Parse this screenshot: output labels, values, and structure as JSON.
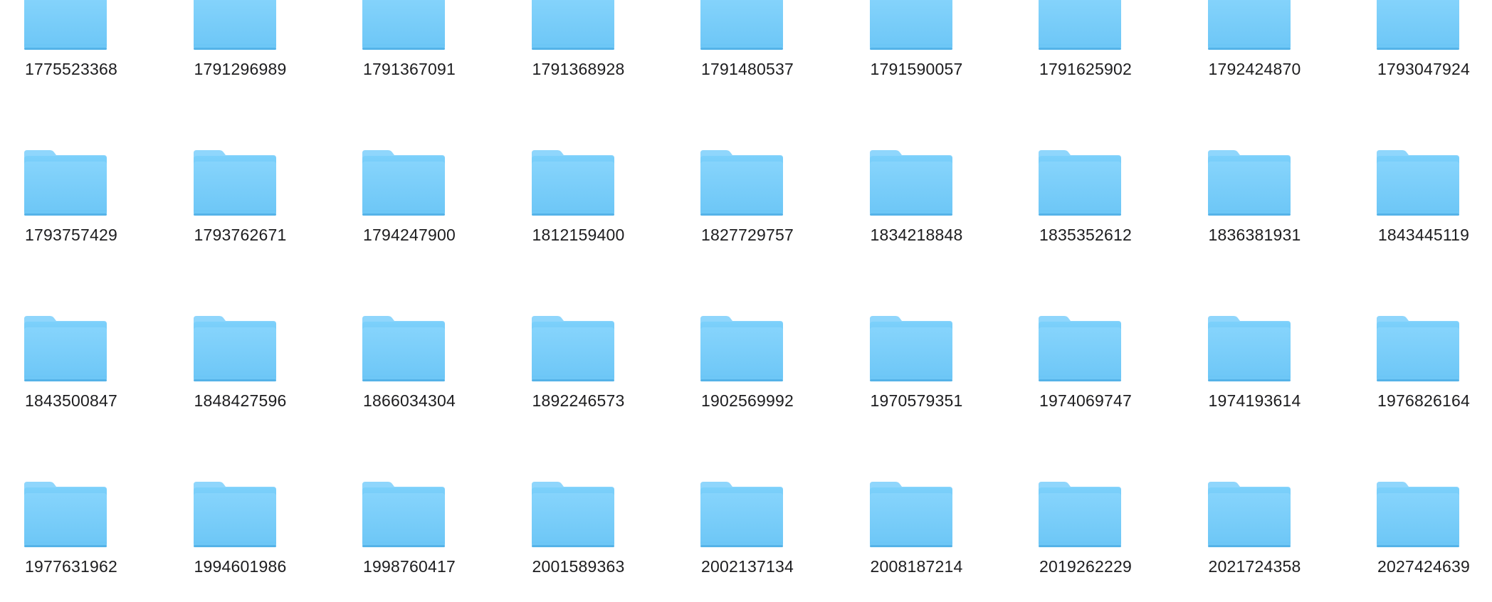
{
  "window": {
    "view": "icon-view"
  },
  "folder_icon": {
    "icon": "folder-icon",
    "colors": {
      "tab": "#8fd6fc",
      "body_top": "#7cd0fb",
      "body_bottom": "#5ebef2",
      "front_top": "#86d4fc",
      "front_bottom": "#6cc6f6",
      "bottom_edge": "#55b3e8"
    }
  },
  "label_color": "#1d1d1f",
  "folders": [
    {
      "name": "1775523368"
    },
    {
      "name": "1791296989"
    },
    {
      "name": "1791367091"
    },
    {
      "name": "1791368928"
    },
    {
      "name": "1791480537"
    },
    {
      "name": "1791590057"
    },
    {
      "name": "1791625902"
    },
    {
      "name": "1792424870"
    },
    {
      "name": "1793047924"
    },
    {
      "name": "1793757429"
    },
    {
      "name": "1793762671"
    },
    {
      "name": "1794247900"
    },
    {
      "name": "1812159400"
    },
    {
      "name": "1827729757"
    },
    {
      "name": "1834218848"
    },
    {
      "name": "1835352612"
    },
    {
      "name": "1836381931"
    },
    {
      "name": "1843445119"
    },
    {
      "name": "1843500847"
    },
    {
      "name": "1848427596"
    },
    {
      "name": "1866034304"
    },
    {
      "name": "1892246573"
    },
    {
      "name": "1902569992"
    },
    {
      "name": "1970579351"
    },
    {
      "name": "1974069747"
    },
    {
      "name": "1974193614"
    },
    {
      "name": "1976826164"
    },
    {
      "name": "1977631962"
    },
    {
      "name": "1994601986"
    },
    {
      "name": "1998760417"
    },
    {
      "name": "2001589363"
    },
    {
      "name": "2002137134"
    },
    {
      "name": "2008187214"
    },
    {
      "name": "2019262229"
    },
    {
      "name": "2021724358"
    },
    {
      "name": "2027424639"
    }
  ]
}
